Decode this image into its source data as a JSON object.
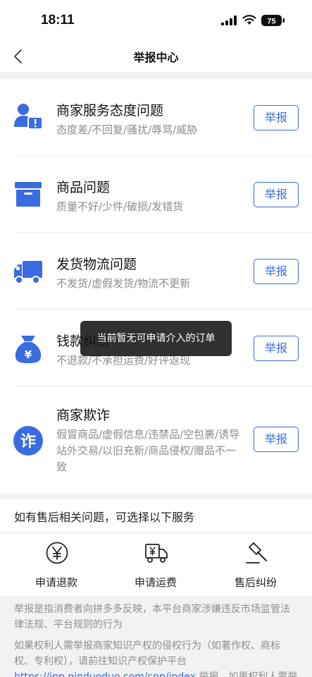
{
  "status_bar": {
    "time": "18:11",
    "battery": "75"
  },
  "nav": {
    "title": "举报中心"
  },
  "items": [
    {
      "title": "商家服务态度问题",
      "desc": "态度差/不回复/骚扰/辱骂/威胁",
      "button": "举报",
      "icon": "merchant-attitude-icon"
    },
    {
      "title": "商品问题",
      "desc": "质量不好/少件/破损/发错货",
      "button": "举报",
      "icon": "product-box-icon"
    },
    {
      "title": "发货物流问题",
      "desc": "不发货/虚假发货/物流不更新",
      "button": "举报",
      "icon": "delivery-truck-icon"
    },
    {
      "title": "钱款纠纷",
      "desc": "不退款/不承担运费/好评返现",
      "button": "举报",
      "icon": "money-bag-icon"
    },
    {
      "title": "商家欺诈",
      "desc": "假冒商品/虚假信息/违禁品/空包裹/诱导站外交易/以旧充新/商品侵权/赠品不一致",
      "button": "举报",
      "icon": "fraud-icon"
    }
  ],
  "toast": {
    "text": "当前暂无可申请介入的订单"
  },
  "after_sales": {
    "heading": "如有售后相关问题，可选择以下服务",
    "services": [
      {
        "label": "申请退款",
        "icon": "refund-yen-icon"
      },
      {
        "label": "申请运费",
        "icon": "shipping-fee-icon"
      },
      {
        "label": "售后纠纷",
        "icon": "gavel-icon"
      }
    ]
  },
  "footer": {
    "para1": "举报是指消费者向拼多多反映，本平台商家涉嫌违反市场监管法律法规、平台规则的行为",
    "para2_prefix": "如果权利人需举报商家知识产权的侵权行为（如著作权、商标权、专利权），请前往知识产权保护平台",
    "para2_link": "https://ipp.pinduoduo.com/cpp/index",
    "para2_suffix": "举报。如果权利人需举报商家侵害"
  },
  "colors": {
    "accent": "#3a6ce0"
  }
}
